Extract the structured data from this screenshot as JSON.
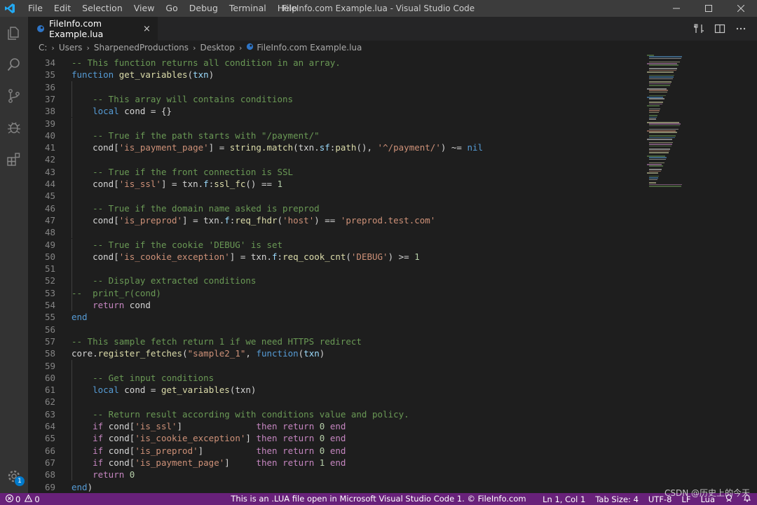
{
  "titlebar": {
    "menu": [
      "File",
      "Edit",
      "Selection",
      "View",
      "Go",
      "Debug",
      "Terminal",
      "Help"
    ],
    "title": "FileInfo.com Example.lua - Visual Studio Code"
  },
  "tab": {
    "label": "FileInfo.com Example.lua",
    "close": "×"
  },
  "breadcrumb": [
    "C:",
    "Users",
    "SharpenedProductions",
    "Desktop",
    "FileInfo.com Example.lua"
  ],
  "activity": {
    "badge": "1"
  },
  "editor": {
    "lines": [
      {
        "n": "34",
        "i": 0,
        "t": [
          [
            "cm",
            "-- This function returns all condition in an array."
          ]
        ]
      },
      {
        "n": "35",
        "i": 0,
        "t": [
          [
            "kw",
            "function"
          ],
          [
            "pl",
            " "
          ],
          [
            "fn",
            "get_variables"
          ],
          [
            "pl",
            "("
          ],
          [
            "var",
            "txn"
          ],
          [
            "pl",
            ")"
          ]
        ]
      },
      {
        "n": "36",
        "i": 1,
        "t": []
      },
      {
        "n": "37",
        "i": 1,
        "t": [
          [
            "pl",
            "    "
          ],
          [
            "cm",
            "-- This array will contains conditions"
          ]
        ]
      },
      {
        "n": "38",
        "i": 1,
        "t": [
          [
            "pl",
            "    "
          ],
          [
            "kw",
            "local"
          ],
          [
            "pl",
            " cond = {}"
          ]
        ]
      },
      {
        "n": "39",
        "i": 1,
        "t": []
      },
      {
        "n": "40",
        "i": 1,
        "t": [
          [
            "pl",
            "    "
          ],
          [
            "cm",
            "-- True if the path starts with \"/payment/\""
          ]
        ]
      },
      {
        "n": "41",
        "i": 1,
        "t": [
          [
            "pl",
            "    cond["
          ],
          [
            "str",
            "'is_payment_page'"
          ],
          [
            "pl",
            "] = "
          ],
          [
            "fn",
            "string.match"
          ],
          [
            "pl",
            "(txn."
          ],
          [
            "var",
            "sf"
          ],
          [
            "pl",
            ":"
          ],
          [
            "fn",
            "path"
          ],
          [
            "pl",
            "(), "
          ],
          [
            "str",
            "'^/payment/'"
          ],
          [
            "pl",
            ") ~= "
          ],
          [
            "kw",
            "nil"
          ]
        ]
      },
      {
        "n": "42",
        "i": 1,
        "t": []
      },
      {
        "n": "43",
        "i": 1,
        "t": [
          [
            "pl",
            "    "
          ],
          [
            "cm",
            "-- True if the front connection is SSL"
          ]
        ]
      },
      {
        "n": "44",
        "i": 1,
        "t": [
          [
            "pl",
            "    cond["
          ],
          [
            "str",
            "'is_ssl'"
          ],
          [
            "pl",
            "] = txn."
          ],
          [
            "var",
            "f"
          ],
          [
            "pl",
            ":"
          ],
          [
            "fn",
            "ssl_fc"
          ],
          [
            "pl",
            "() == "
          ],
          [
            "num",
            "1"
          ]
        ]
      },
      {
        "n": "45",
        "i": 1,
        "t": []
      },
      {
        "n": "46",
        "i": 1,
        "t": [
          [
            "pl",
            "    "
          ],
          [
            "cm",
            "-- True if the domain name asked is preprod"
          ]
        ]
      },
      {
        "n": "47",
        "i": 1,
        "t": [
          [
            "pl",
            "    cond["
          ],
          [
            "str",
            "'is_preprod'"
          ],
          [
            "pl",
            "] = txn."
          ],
          [
            "var",
            "f"
          ],
          [
            "pl",
            ":"
          ],
          [
            "fn",
            "req_fhdr"
          ],
          [
            "pl",
            "("
          ],
          [
            "str",
            "'host'"
          ],
          [
            "pl",
            ") == "
          ],
          [
            "str",
            "'preprod.test.com'"
          ]
        ]
      },
      {
        "n": "48",
        "i": 1,
        "t": []
      },
      {
        "n": "49",
        "i": 1,
        "t": [
          [
            "pl",
            "    "
          ],
          [
            "cm",
            "-- True if the cookie 'DEBUG' is set"
          ]
        ]
      },
      {
        "n": "50",
        "i": 1,
        "t": [
          [
            "pl",
            "    cond["
          ],
          [
            "str",
            "'is_cookie_exception'"
          ],
          [
            "pl",
            "] = txn."
          ],
          [
            "var",
            "f"
          ],
          [
            "pl",
            ":"
          ],
          [
            "fn",
            "req_cook_cnt"
          ],
          [
            "pl",
            "("
          ],
          [
            "str",
            "'DEBUG'"
          ],
          [
            "pl",
            ") >= "
          ],
          [
            "num",
            "1"
          ]
        ]
      },
      {
        "n": "51",
        "i": 1,
        "t": []
      },
      {
        "n": "52",
        "i": 1,
        "t": [
          [
            "pl",
            "    "
          ],
          [
            "cm",
            "-- Display extracted conditions"
          ]
        ]
      },
      {
        "n": "53",
        "i": 1,
        "t": [
          [
            "cm",
            "--  print_r(cond)"
          ]
        ]
      },
      {
        "n": "54",
        "i": 1,
        "t": [
          [
            "pl",
            "    "
          ],
          [
            "ctl",
            "return"
          ],
          [
            "pl",
            " cond"
          ]
        ]
      },
      {
        "n": "55",
        "i": 0,
        "t": [
          [
            "kw",
            "end"
          ]
        ]
      },
      {
        "n": "56",
        "i": 0,
        "t": []
      },
      {
        "n": "57",
        "i": 0,
        "t": [
          [
            "cm",
            "-- This sample fetch return 1 if we need HTTPS redirect"
          ]
        ]
      },
      {
        "n": "58",
        "i": 0,
        "t": [
          [
            "pl",
            "core."
          ],
          [
            "fn",
            "register_fetches"
          ],
          [
            "pl",
            "("
          ],
          [
            "str",
            "\"sample2_1\""
          ],
          [
            "pl",
            ", "
          ],
          [
            "kw",
            "function"
          ],
          [
            "pl",
            "("
          ],
          [
            "var",
            "txn"
          ],
          [
            "pl",
            ")"
          ]
        ]
      },
      {
        "n": "59",
        "i": 1,
        "t": []
      },
      {
        "n": "60",
        "i": 1,
        "t": [
          [
            "pl",
            "    "
          ],
          [
            "cm",
            "-- Get input conditions"
          ]
        ]
      },
      {
        "n": "61",
        "i": 1,
        "t": [
          [
            "pl",
            "    "
          ],
          [
            "kw",
            "local"
          ],
          [
            "pl",
            " cond = "
          ],
          [
            "fn",
            "get_variables"
          ],
          [
            "pl",
            "(txn)"
          ]
        ]
      },
      {
        "n": "62",
        "i": 1,
        "t": []
      },
      {
        "n": "63",
        "i": 1,
        "t": [
          [
            "pl",
            "    "
          ],
          [
            "cm",
            "-- Return result according with conditions value and policy."
          ]
        ]
      },
      {
        "n": "64",
        "i": 1,
        "t": [
          [
            "pl",
            "    "
          ],
          [
            "ctl",
            "if"
          ],
          [
            "pl",
            " cond["
          ],
          [
            "str",
            "'is_ssl'"
          ],
          [
            "pl",
            "]              "
          ],
          [
            "ctl",
            "then"
          ],
          [
            "pl",
            " "
          ],
          [
            "ctl",
            "return"
          ],
          [
            "pl",
            " "
          ],
          [
            "num",
            "0"
          ],
          [
            "pl",
            " "
          ],
          [
            "ctl",
            "end"
          ]
        ]
      },
      {
        "n": "65",
        "i": 1,
        "t": [
          [
            "pl",
            "    "
          ],
          [
            "ctl",
            "if"
          ],
          [
            "pl",
            " cond["
          ],
          [
            "str",
            "'is_cookie_exception'"
          ],
          [
            "pl",
            "] "
          ],
          [
            "ctl",
            "then"
          ],
          [
            "pl",
            " "
          ],
          [
            "ctl",
            "return"
          ],
          [
            "pl",
            " "
          ],
          [
            "num",
            "0"
          ],
          [
            "pl",
            " "
          ],
          [
            "ctl",
            "end"
          ]
        ]
      },
      {
        "n": "66",
        "i": 1,
        "t": [
          [
            "pl",
            "    "
          ],
          [
            "ctl",
            "if"
          ],
          [
            "pl",
            " cond["
          ],
          [
            "str",
            "'is_preprod'"
          ],
          [
            "pl",
            "]          "
          ],
          [
            "ctl",
            "then"
          ],
          [
            "pl",
            " "
          ],
          [
            "ctl",
            "return"
          ],
          [
            "pl",
            " "
          ],
          [
            "num",
            "0"
          ],
          [
            "pl",
            " "
          ],
          [
            "ctl",
            "end"
          ]
        ]
      },
      {
        "n": "67",
        "i": 1,
        "t": [
          [
            "pl",
            "    "
          ],
          [
            "ctl",
            "if"
          ],
          [
            "pl",
            " cond["
          ],
          [
            "str",
            "'is_payment_page'"
          ],
          [
            "pl",
            "]     "
          ],
          [
            "ctl",
            "then"
          ],
          [
            "pl",
            " "
          ],
          [
            "ctl",
            "return"
          ],
          [
            "pl",
            " "
          ],
          [
            "num",
            "1"
          ],
          [
            "pl",
            " "
          ],
          [
            "ctl",
            "end"
          ]
        ]
      },
      {
        "n": "68",
        "i": 1,
        "t": [
          [
            "pl",
            "    "
          ],
          [
            "ctl",
            "return"
          ],
          [
            "pl",
            " "
          ],
          [
            "num",
            "0"
          ]
        ]
      },
      {
        "n": "69",
        "i": 0,
        "t": [
          [
            "kw",
            "end"
          ],
          [
            "pl",
            ")"
          ]
        ]
      }
    ]
  },
  "statusbar": {
    "errors": "0",
    "warnings": "0",
    "message": "This is an .LUA file open in Microsoft Visual Studio Code 1. © FileInfo.com",
    "position": "Ln 1, Col 1",
    "tab_size": "Tab Size: 4",
    "encoding": "UTF-8",
    "eol": "LF",
    "language": "Lua"
  },
  "watermark": "CSDN @历史上的今天",
  "colors": {
    "statusbar": "#68217a",
    "keyword": "#569cd6",
    "comment": "#6a9955",
    "string": "#ce9178",
    "function": "#dcdcaa",
    "number": "#b5cea8"
  }
}
